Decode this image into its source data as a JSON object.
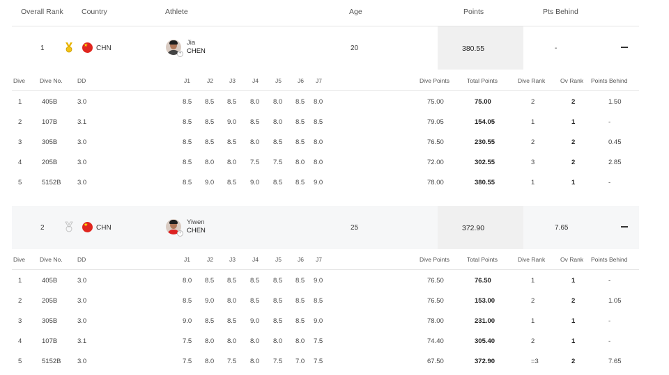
{
  "header": {
    "overall_rank": "Overall Rank",
    "country": "Country",
    "athlete": "Athlete",
    "age": "Age",
    "points": "Points",
    "pts_behind": "Pts Behind"
  },
  "dive_columns": [
    "Dive",
    "Dive No.",
    "DD",
    "J1",
    "J2",
    "J3",
    "J4",
    "J5",
    "J6",
    "J7",
    "Dive Points",
    "Total Points",
    "Dive Rank",
    "Ov Rank",
    "Points Behind"
  ],
  "athletes": [
    {
      "rank": "1",
      "medal_icon": "gold-medal-icon",
      "country": "CHN",
      "given_name": "Jia",
      "family_name": "CHEN",
      "age": "20",
      "points": "380.55",
      "pts_behind": "-",
      "dives": [
        {
          "dive": "1",
          "no": "405B",
          "dd": "3.0",
          "j": [
            "8.5",
            "8.5",
            "8.5",
            "8.0",
            "8.0",
            "8.5",
            "8.0"
          ],
          "dive_points": "75.00",
          "total": "75.00",
          "dive_rank": "2",
          "ov_rank": "2",
          "behind": "1.50"
        },
        {
          "dive": "2",
          "no": "107B",
          "dd": "3.1",
          "j": [
            "8.5",
            "8.5",
            "9.0",
            "8.5",
            "8.0",
            "8.5",
            "8.5"
          ],
          "dive_points": "79.05",
          "total": "154.05",
          "dive_rank": "1",
          "ov_rank": "1",
          "behind": "-"
        },
        {
          "dive": "3",
          "no": "305B",
          "dd": "3.0",
          "j": [
            "8.5",
            "8.5",
            "8.5",
            "8.0",
            "8.5",
            "8.5",
            "8.0"
          ],
          "dive_points": "76.50",
          "total": "230.55",
          "dive_rank": "2",
          "ov_rank": "2",
          "behind": "0.45"
        },
        {
          "dive": "4",
          "no": "205B",
          "dd": "3.0",
          "j": [
            "8.5",
            "8.0",
            "8.0",
            "7.5",
            "7.5",
            "8.0",
            "8.0"
          ],
          "dive_points": "72.00",
          "total": "302.55",
          "dive_rank": "3",
          "ov_rank": "2",
          "behind": "2.85"
        },
        {
          "dive": "5",
          "no": "5152B",
          "dd": "3.0",
          "j": [
            "8.5",
            "9.0",
            "8.5",
            "9.0",
            "8.5",
            "8.5",
            "9.0"
          ],
          "dive_points": "78.00",
          "total": "380.55",
          "dive_rank": "1",
          "ov_rank": "1",
          "behind": "-"
        }
      ]
    },
    {
      "rank": "2",
      "medal_icon": "silver-medal-icon",
      "country": "CHN",
      "given_name": "Yiwen",
      "family_name": "CHEN",
      "age": "25",
      "points": "372.90",
      "pts_behind": "7.65",
      "dives": [
        {
          "dive": "1",
          "no": "405B",
          "dd": "3.0",
          "j": [
            "8.0",
            "8.5",
            "8.5",
            "8.5",
            "8.5",
            "8.5",
            "9.0"
          ],
          "dive_points": "76.50",
          "total": "76.50",
          "dive_rank": "1",
          "ov_rank": "1",
          "behind": "-"
        },
        {
          "dive": "2",
          "no": "205B",
          "dd": "3.0",
          "j": [
            "8.5",
            "9.0",
            "8.0",
            "8.5",
            "8.5",
            "8.5",
            "8.5"
          ],
          "dive_points": "76.50",
          "total": "153.00",
          "dive_rank": "2",
          "ov_rank": "2",
          "behind": "1.05"
        },
        {
          "dive": "3",
          "no": "305B",
          "dd": "3.0",
          "j": [
            "9.0",
            "8.5",
            "8.5",
            "9.0",
            "8.5",
            "8.5",
            "9.0"
          ],
          "dive_points": "78.00",
          "total": "231.00",
          "dive_rank": "1",
          "ov_rank": "1",
          "behind": "-"
        },
        {
          "dive": "4",
          "no": "107B",
          "dd": "3.1",
          "j": [
            "7.5",
            "8.0",
            "8.0",
            "8.0",
            "8.0",
            "8.0",
            "7.5"
          ],
          "dive_points": "74.40",
          "total": "305.40",
          "dive_rank": "2",
          "ov_rank": "1",
          "behind": "-"
        },
        {
          "dive": "5",
          "no": "5152B",
          "dd": "3.0",
          "j": [
            "7.5",
            "8.0",
            "7.5",
            "8.0",
            "7.5",
            "7.0",
            "7.5"
          ],
          "dive_points": "67.50",
          "total": "372.90",
          "dive_rank": "=3",
          "ov_rank": "2",
          "behind": "7.65"
        }
      ]
    }
  ],
  "colors": {
    "flag_red": "#e0261f",
    "gold": "#e8b400",
    "silver": "#b9b9b9",
    "shade": "#f6f7f8"
  }
}
